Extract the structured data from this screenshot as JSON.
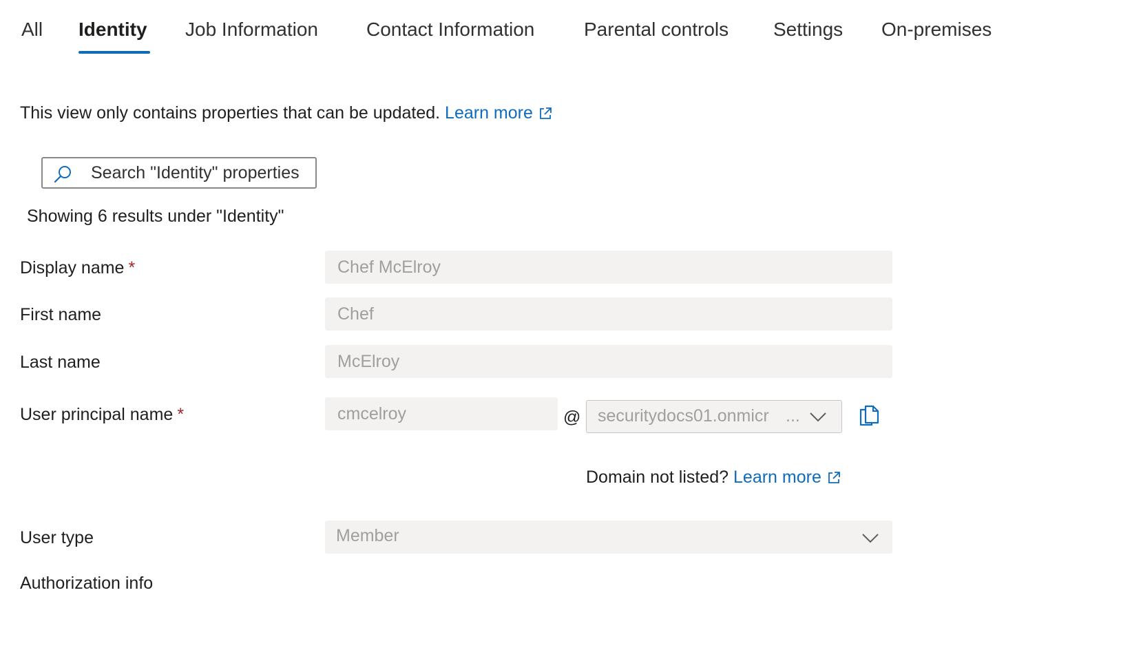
{
  "tabs": [
    {
      "label": "All",
      "active": false
    },
    {
      "label": "Identity",
      "active": true
    },
    {
      "label": "Job Information",
      "active": false
    },
    {
      "label": "Contact Information",
      "active": false
    },
    {
      "label": "Parental controls",
      "active": false
    },
    {
      "label": "Settings",
      "active": false
    },
    {
      "label": "On-premises",
      "active": false
    }
  ],
  "info": {
    "text": "This view only contains properties that can be updated.",
    "link": "Learn more",
    "link_icon": "external-link-icon"
  },
  "search": {
    "placeholder": "Search \"Identity\" properties",
    "icon": "search-icon"
  },
  "results_text": "Showing 6 results under \"Identity\"",
  "form": {
    "display_name": {
      "label": "Display name",
      "required": "*",
      "value": "Chef McElroy"
    },
    "first_name": {
      "label": "First name",
      "value": "Chef"
    },
    "last_name": {
      "label": "Last name",
      "value": "McElroy"
    },
    "upn": {
      "label": "User principal name",
      "required": "*",
      "value": "cmcelroy",
      "at": "@",
      "domain": "securitydocs01.onmicr",
      "domain_ellipsis": "...",
      "copy_icon": "copy-icon"
    },
    "domain_note": {
      "text": "Domain not listed?",
      "link": "Learn more"
    },
    "user_type": {
      "label": "User type",
      "value": "Member"
    },
    "authorization_info": {
      "label": "Authorization info"
    }
  },
  "colors": {
    "accent": "#0f6cbd",
    "required": "#a4262c",
    "field_bg": "#f3f2f1",
    "disabled_text": "#a19f9d"
  }
}
